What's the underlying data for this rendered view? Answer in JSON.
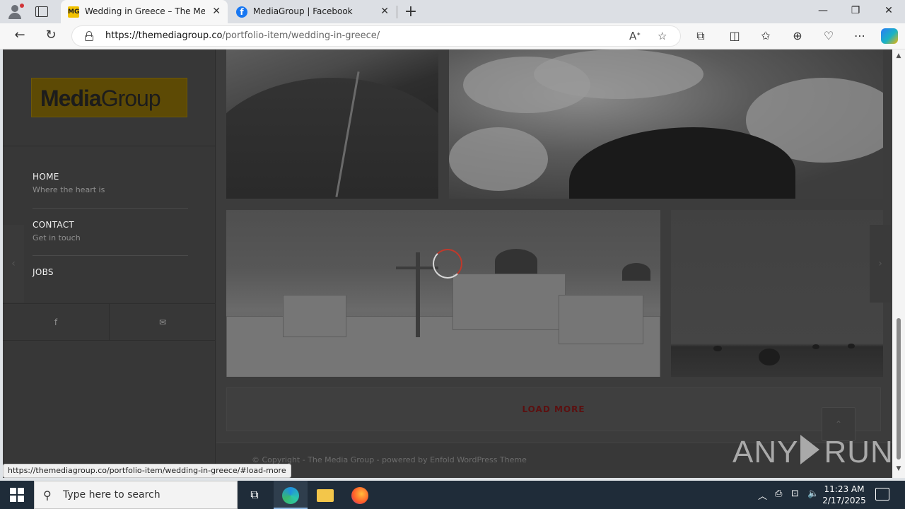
{
  "browser": {
    "tabs": [
      {
        "favicon": "MG",
        "title": "Wedding in Greece – The Media Group",
        "active": true
      },
      {
        "favicon": "f",
        "title": "MediaGroup | Facebook",
        "active": false
      }
    ],
    "url_host": "https://themediagroup.co",
    "url_path": "/portfolio-item/wedding-in-greece/",
    "status_url": "https://themediagroup.co/portfolio-item/wedding-in-greece/#load-more"
  },
  "site": {
    "logo_bold": "Media",
    "logo_light": "Group",
    "menu": [
      {
        "title": "HOME",
        "subtitle": "Where the heart is"
      },
      {
        "title": "CONTACT",
        "subtitle": "Get in touch"
      },
      {
        "title": "JOBS",
        "subtitle": ""
      }
    ],
    "social": {
      "facebook": "f",
      "mail": "✉"
    },
    "load_more": "LOAD MORE",
    "footer": "© Copyright - The Media Group - powered by Enfold WordPress Theme",
    "back_to_top": "⌃"
  },
  "watermark": {
    "left": "ANY",
    "right": "RUN"
  },
  "taskbar": {
    "search_placeholder": "Type here to search",
    "time": "11:23 AM",
    "date": "2/17/2025"
  }
}
